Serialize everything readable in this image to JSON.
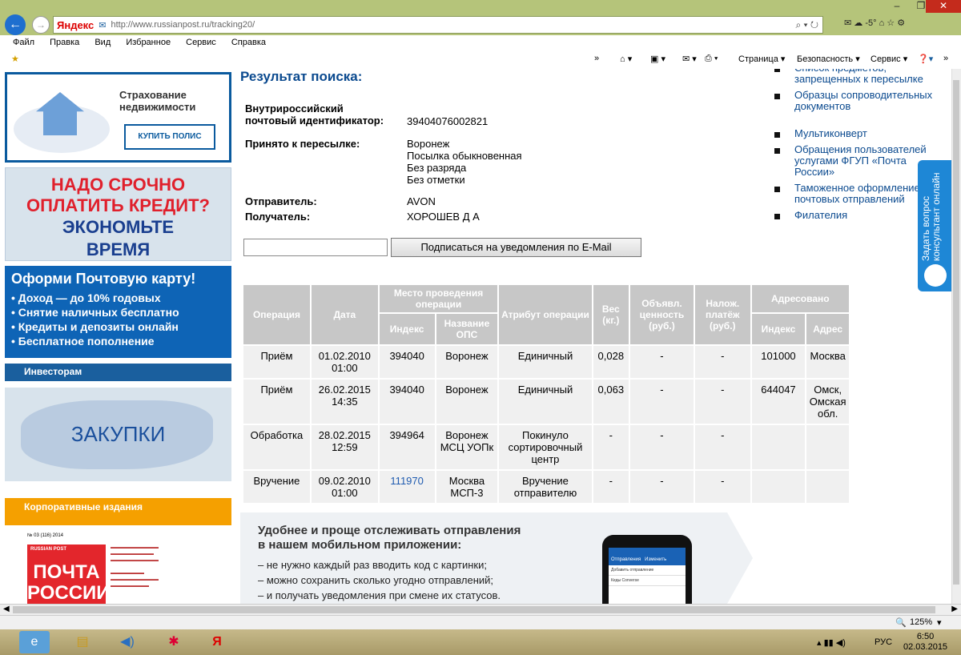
{
  "browser": {
    "url": "http://www.russianpost.ru/tracking20/",
    "yandex_label": "Яндекс",
    "weather": "-5°",
    "menu": [
      "Файл",
      "Правка",
      "Вид",
      "Избранное",
      "Сервис",
      "Справка"
    ],
    "toolbar": {
      "page": "Страница ▾",
      "security": "Безопасность ▾",
      "service": "Сервис ▾"
    }
  },
  "left": {
    "insurance": {
      "title_line1": "Страхование",
      "title_line2": "недвижимости",
      "button": "КУПИТЬ ПОЛИС"
    },
    "credit": {
      "line1": "НАДО СРОЧНО",
      "line2": "ОПЛАТИТЬ КРЕДИТ?",
      "line3": "ЭКОНОМЬТЕ",
      "line4": "ВРЕМЯ"
    },
    "card": {
      "title": "Оформи Почтовую карту!",
      "items": [
        "• Доход — до 10% годовых",
        "• Снятие наличных бесплатно",
        "• Кредиты и депозиты онлайн",
        "• Бесплатное пополнение"
      ]
    },
    "investors": "Инвесторам",
    "purchases": "ЗАКУПКИ",
    "corporate": "Корпоративные издания",
    "magazine": {
      "issue": "№ 03 (116) 2014",
      "brand_small": "RUSSIAN POST",
      "title_line1": "ПОЧТА",
      "title_line2": "РОССИИ"
    }
  },
  "main": {
    "title": "Результат поиска:",
    "id_label_1": "Внутрироссийский",
    "id_label_2": "почтовый идентификатор:",
    "id_value": "39404076002821",
    "accepted_label": "Принято к пересылке:",
    "accepted_values": [
      "Воронеж",
      "Посылка обыкновенная",
      "Без разряда",
      "Без отметки"
    ],
    "sender_label": "Отправитель:",
    "sender": "AVON",
    "recipient_label": "Получатель:",
    "recipient": "ХОРОШЕВ Д А",
    "subscribe_input": "",
    "subscribe_button": "Подписаться на уведомления по E-Mail"
  },
  "table": {
    "headers": {
      "operation": "Операция",
      "date": "Дата",
      "place": "Место проведения операции",
      "index": "Индекс",
      "ops_name": "Название ОПС",
      "attribute": "Атрибут операции",
      "weight": "Вес (кг.)",
      "declared": "Объявл. ценность (руб.)",
      "cod": "Налож. платёж (руб.)",
      "addressed": "Адресовано",
      "addr_index": "Индекс",
      "addr": "Адрес"
    },
    "rows": [
      {
        "op": "Приём",
        "date": "01.02.2010",
        "time": "01:00",
        "index": "394040",
        "ops": "Воронеж",
        "ops2": "",
        "attr": "Единичный",
        "weight": "0,028",
        "declared": "-",
        "cod": "-",
        "to_index": "101000",
        "to_addr": "Москва"
      },
      {
        "op": "Приём",
        "date": "26.02.2015",
        "time": "14:35",
        "index": "394040",
        "ops": "Воронеж",
        "ops2": "",
        "attr": "Единичный",
        "weight": "0,063",
        "declared": "-",
        "cod": "-",
        "to_index": "644047",
        "to_addr": "Омск, Омская обл."
      },
      {
        "op": "Обработка",
        "date": "28.02.2015",
        "time": "12:59",
        "index": "394964",
        "ops": "Воронеж",
        "ops2": "МСЦ УОПк",
        "attr": "Покинуло сортировочный центр",
        "weight": "-",
        "declared": "-",
        "cod": "-",
        "to_index": "",
        "to_addr": ""
      },
      {
        "op": "Вручение",
        "date": "09.02.2010",
        "time": "01:00",
        "index": "111970",
        "ops": "Москва",
        "ops2": "МСП-3",
        "attr": "Вручение отправителю",
        "weight": "-",
        "declared": "-",
        "cod": "-",
        "to_index": "",
        "to_addr": ""
      }
    ]
  },
  "right": {
    "links": [
      "Список предметов, запрещенных к пересылке",
      "Образцы сопроводительных документов",
      "Мультиконверт",
      "Обращения пользователей услугами ФГУП «Почта России»",
      "Таможенное оформление почтовых отправлений",
      "Филателия"
    ],
    "ask_tab": "Задать вопрос консультант онлайн"
  },
  "promo": {
    "title_line1": "Удобнее и проще отслеживать отправления",
    "title_line2": "в нашем мобильном приложении:",
    "items": [
      "– не нужно каждый раз вводить код с картинки;",
      "– можно сохранить сколько угодно отправлений;",
      "– и получать уведомления при смене их статусов."
    ],
    "phone_tab1": "Отправления",
    "phone_tab2": "Изменить",
    "phone_add": "Добавить отправление",
    "phone_item": "Кеды Converse"
  },
  "status": {
    "zoom": "125%"
  },
  "taskbar": {
    "lang": "РУС",
    "time": "6:50",
    "date": "02.03.2015"
  }
}
